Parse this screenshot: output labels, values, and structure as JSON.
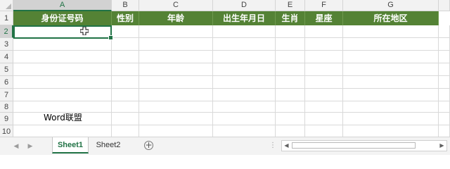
{
  "column_headers": [
    "A",
    "B",
    "C",
    "D",
    "E",
    "F",
    "G"
  ],
  "row_headers": [
    "1",
    "2",
    "3",
    "4",
    "5",
    "6",
    "7",
    "8",
    "9",
    "10"
  ],
  "table_header": [
    "身份证号码",
    "性别",
    "年龄",
    "出生年月日",
    "生肖",
    "星座",
    "所在地区"
  ],
  "selected_cell": "A2",
  "watermark_text": "Word联盟",
  "sheet_tabs": [
    "Sheet1",
    "Sheet2"
  ],
  "active_sheet": "Sheet1",
  "colors": {
    "header_fill": "#548235",
    "accent": "#217346"
  }
}
